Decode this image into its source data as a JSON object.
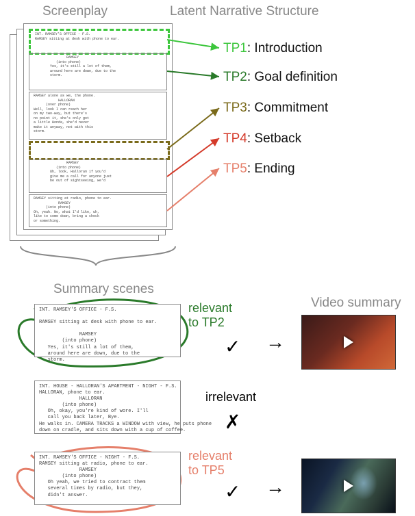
{
  "top_labels": {
    "screenplay": "Screenplay",
    "latent": "Latent Narrative Structure"
  },
  "tp": [
    {
      "name": "TP1",
      "desc": "Introduction",
      "color": "#3cc63c"
    },
    {
      "name": "TP2",
      "desc": "Goal definition",
      "color": "#2a7a2a"
    },
    {
      "name": "TP3",
      "desc": "Commitment",
      "color": "#7a6a1a"
    },
    {
      "name": "TP4",
      "desc": "Setback",
      "color": "#d43a2a"
    },
    {
      "name": "TP5",
      "desc": "Ending",
      "color": "#e57f6a"
    }
  ],
  "section_labels": {
    "summary_scenes": "Summary scenes",
    "video_summary": "Video summary"
  },
  "relevance": {
    "rel_tp2": "relevant\nto TP2",
    "irrelevant": "irrelevant",
    "rel_tp5": "relevant\nto TP5"
  },
  "marks": {
    "check": "✓",
    "cross": "✗",
    "arrow": "→"
  }
}
